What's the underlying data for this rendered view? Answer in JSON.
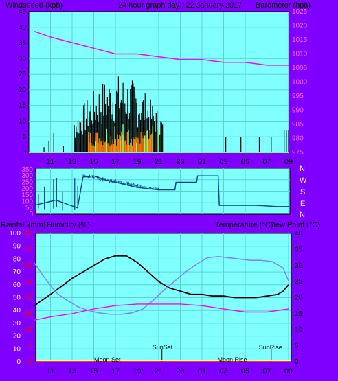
{
  "header": {
    "left": "Windspeed (kph)",
    "center": "24 hour graph day : 22 January 2017",
    "right": "Barometer (hpa)"
  },
  "mid_header": {
    "rainfall": "Rainfall (mm)",
    "humidity": "Humidity (%)",
    "temperature": "Temperature (°C)",
    "dewpoint": "Dew Point (°C)"
  },
  "wind_dir_labels": [
    "N",
    "W",
    "S",
    "E",
    "N"
  ],
  "annotations": {
    "sunset": "SunSet",
    "sunrise": "SunRise",
    "moonset": "Moon Set",
    "moonrise": "Moon Rise"
  },
  "colors": {
    "background": "#8000ff",
    "plot_bg": "#80ffff",
    "wind_gust": "#000000",
    "wind_avg": "#ff8000",
    "wind_light": "#80ff80",
    "barometer": "#ff00ff",
    "direction": "#004080",
    "temperature": "#000000",
    "humidity": "#8080ff",
    "dewpoint": "#ff00ff",
    "rain": "#ff0000"
  },
  "chart_data": [
    {
      "type": "line",
      "name": "wind-barometer",
      "x_ticks": [
        "11",
        "13",
        "15",
        "17",
        "19",
        "21",
        "23",
        "01",
        "03",
        "05",
        "07",
        "09"
      ],
      "y_left_ticks": [
        0,
        5,
        10,
        15,
        20,
        25,
        30,
        35,
        40,
        45
      ],
      "y_left_range": [
        0,
        45
      ],
      "y_right_ticks": [
        975,
        980,
        985,
        990,
        995,
        1000,
        1005,
        1010,
        1015,
        1020,
        1025
      ],
      "y_right_range": [
        975,
        1025
      ],
      "series": [
        {
          "name": "Barometer (hpa)",
          "axis": "right",
          "x": [
            9.5,
            11,
            13,
            15,
            17,
            19,
            21,
            23,
            25,
            27,
            29,
            31,
            33
          ],
          "y": [
            1018,
            1016,
            1014,
            1012,
            1010,
            1010,
            1009,
            1008,
            1008,
            1007,
            1007,
            1006,
            1006
          ]
        }
      ],
      "gust_spikes": {
        "x_range": [
          13.2,
          21.4
        ],
        "peak": 25
      },
      "avg_bars": {
        "x_range": [
          14.5,
          20.5
        ],
        "peak": 7
      },
      "late_spikes": {
        "x": [
          27.2,
          28.6,
          30.3,
          31.4,
          32.6,
          32.8,
          33.0
        ],
        "y": [
          5,
          5,
          5,
          5,
          7,
          7,
          7
        ]
      }
    },
    {
      "type": "line",
      "name": "wind-direction",
      "x_ticks": [
        "11",
        "13",
        "15",
        "17",
        "19",
        "21",
        "23",
        "01",
        "03",
        "05",
        "07",
        "09"
      ],
      "y_range": [
        0,
        360
      ],
      "y_ticks": [
        0,
        50,
        100,
        150,
        200,
        250,
        300,
        350
      ],
      "series": [
        {
          "name": "Wind direction",
          "x": [
            9.5,
            10.5,
            11.5,
            12.5,
            13.5,
            14,
            15,
            16,
            17,
            18,
            19,
            20,
            21,
            21.5,
            22.5,
            22.6,
            24.5,
            24.6,
            26.5,
            26.6,
            28,
            29,
            30,
            31,
            32,
            33
          ],
          "y": [
            70,
            90,
            110,
            80,
            50,
            290,
            300,
            270,
            250,
            230,
            210,
            200,
            190,
            190,
            190,
            250,
            250,
            300,
            300,
            70,
            70,
            70,
            70,
            65,
            60,
            60
          ]
        }
      ]
    },
    {
      "type": "line",
      "name": "temperature-humidity",
      "x_ticks": [
        "11",
        "13",
        "15",
        "17",
        "19",
        "21",
        "23",
        "01",
        "03",
        "05",
        "07",
        "09"
      ],
      "y_left_ticks": [
        0,
        10,
        20,
        30,
        40,
        50,
        60,
        70,
        80,
        90,
        100
      ],
      "y_left_range": [
        0,
        100
      ],
      "y_right_ticks": [
        0,
        5,
        10,
        15,
        20,
        25,
        30,
        35,
        40
      ],
      "y_right_range": [
        0,
        40
      ],
      "rain_ticks": [
        0,
        5,
        10,
        15,
        20,
        25,
        30,
        35,
        40
      ],
      "series": [
        {
          "name": "Temperature (°C)",
          "axis": "right",
          "x": [
            9.5,
            11,
            12,
            13,
            14,
            15,
            16,
            17,
            18,
            19,
            20,
            21,
            22,
            23,
            24,
            25,
            26,
            27,
            28,
            29,
            30,
            31,
            32,
            32.5,
            33
          ],
          "y": [
            17.5,
            21,
            23.5,
            26,
            28,
            30,
            32,
            33,
            33,
            31,
            28,
            25,
            23,
            22,
            21,
            21,
            20.5,
            20.5,
            20,
            20,
            20,
            20.5,
            21,
            22,
            24
          ]
        },
        {
          "name": "Humidity (%)",
          "axis": "left",
          "x": [
            9.5,
            10.5,
            11.5,
            12.5,
            13.5,
            14.5,
            15.5,
            16.5,
            17.5,
            18.5,
            19.5,
            20.5,
            21.5,
            22.5,
            23.5,
            24.5,
            25.5,
            26.5,
            27.5,
            28.5,
            29.5,
            30.5,
            31.5,
            32.5,
            33
          ],
          "y": [
            77,
            65,
            54,
            48,
            43,
            40,
            38,
            37,
            37,
            38,
            41,
            48,
            56,
            63,
            70,
            76,
            81,
            82,
            81,
            80,
            79,
            79,
            78,
            73,
            63
          ]
        },
        {
          "name": "Dew Point (°C)",
          "axis": "right",
          "x": [
            9.5,
            11,
            13,
            15,
            17,
            19,
            21,
            23,
            25,
            27,
            29,
            31,
            33
          ],
          "y": [
            13,
            14,
            15,
            16.5,
            17.5,
            18,
            18,
            18,
            17.5,
            16.5,
            15.5,
            15.5,
            16.5
          ]
        },
        {
          "name": "Rainfall (mm)",
          "axis": "rain",
          "x": [
            9.5,
            33
          ],
          "y": [
            0,
            0
          ]
        }
      ],
      "markers": {
        "sunset": 21.3,
        "sunrise": 31.4,
        "moonset": 16.3,
        "moonrise": 27.7
      }
    }
  ]
}
